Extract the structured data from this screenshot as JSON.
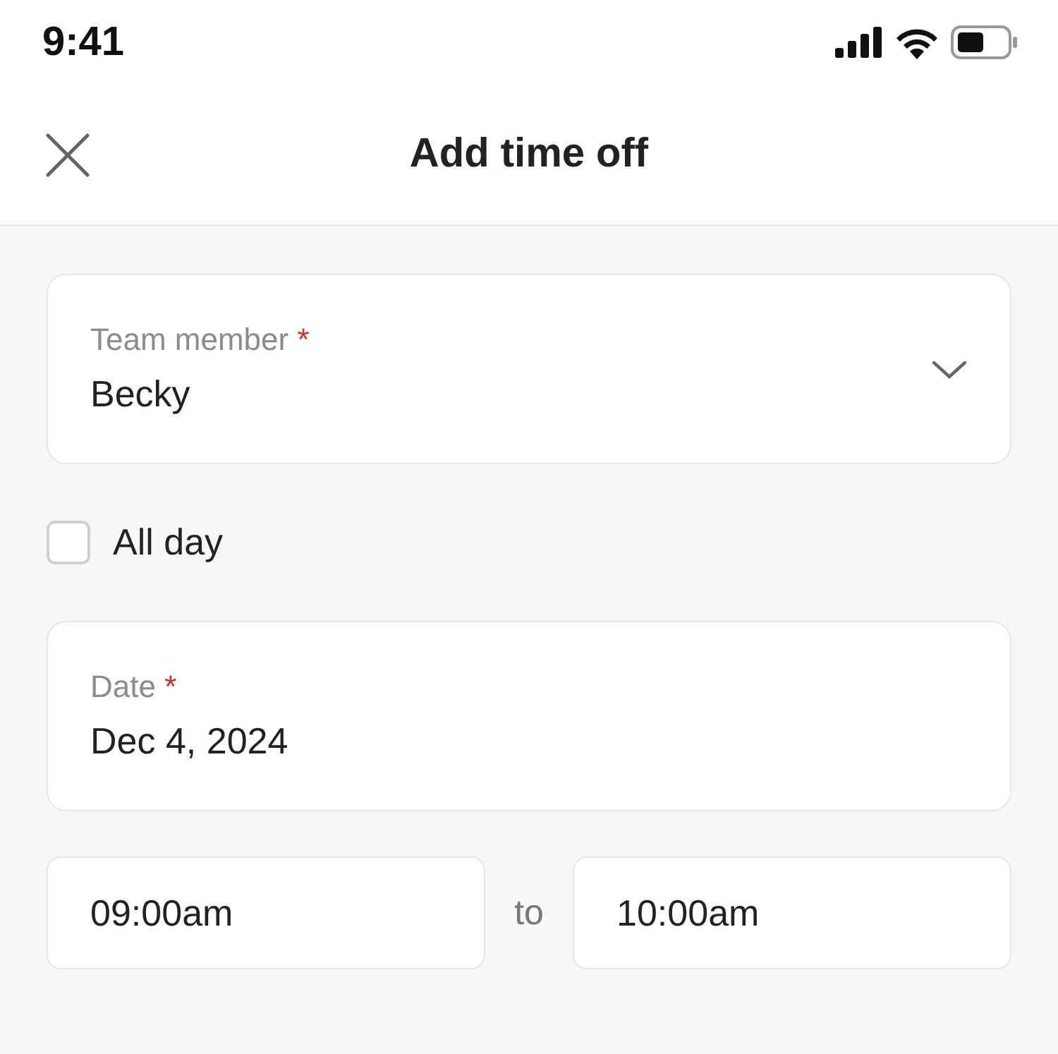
{
  "status_bar": {
    "time": "9:41"
  },
  "header": {
    "title": "Add time off"
  },
  "team_member": {
    "label": "Team member",
    "required_mark": "*",
    "value": "Becky"
  },
  "all_day": {
    "label": "All day",
    "checked": false
  },
  "date": {
    "label": "Date",
    "required_mark": "*",
    "value": "Dec 4, 2024"
  },
  "time_range": {
    "start": "09:00am",
    "separator": "to",
    "end": "10:00am"
  }
}
